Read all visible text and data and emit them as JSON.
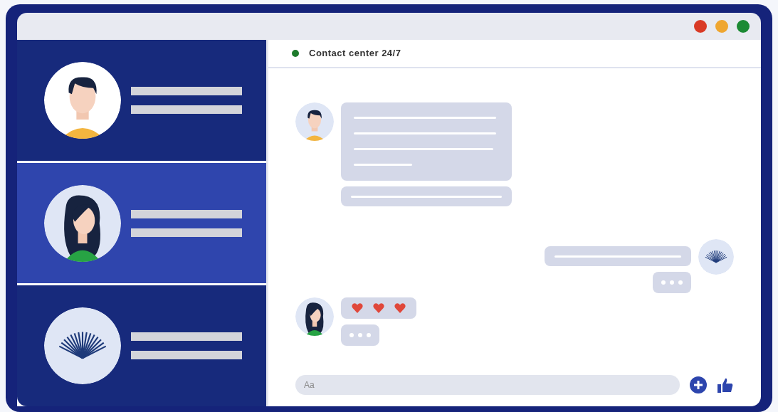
{
  "contacts": [
    {
      "avatar": {
        "kind": "man"
      },
      "selected": false
    },
    {
      "avatar": {
        "kind": "woman"
      },
      "selected": true
    },
    {
      "avatar": {
        "kind": "fan"
      },
      "selected": false
    }
  ],
  "header": {
    "title": "Contact center 24/7",
    "online": true
  },
  "messages": [
    {
      "outgoing": false,
      "avatar": {
        "kind": "man"
      },
      "bubbles": [
        {
          "kind": "paragraph"
        },
        {
          "kind": "line"
        }
      ]
    },
    {
      "outgoing": true,
      "avatar": {
        "kind": "fan"
      },
      "bubbles": [
        {
          "kind": "line"
        },
        {
          "kind": "typing"
        }
      ]
    },
    {
      "outgoing": false,
      "avatar": {
        "kind": "woman"
      },
      "bubbles": [
        {
          "kind": "hearts"
        },
        {
          "kind": "typing"
        }
      ]
    }
  ],
  "composer": {
    "placeholder": "Aa"
  }
}
